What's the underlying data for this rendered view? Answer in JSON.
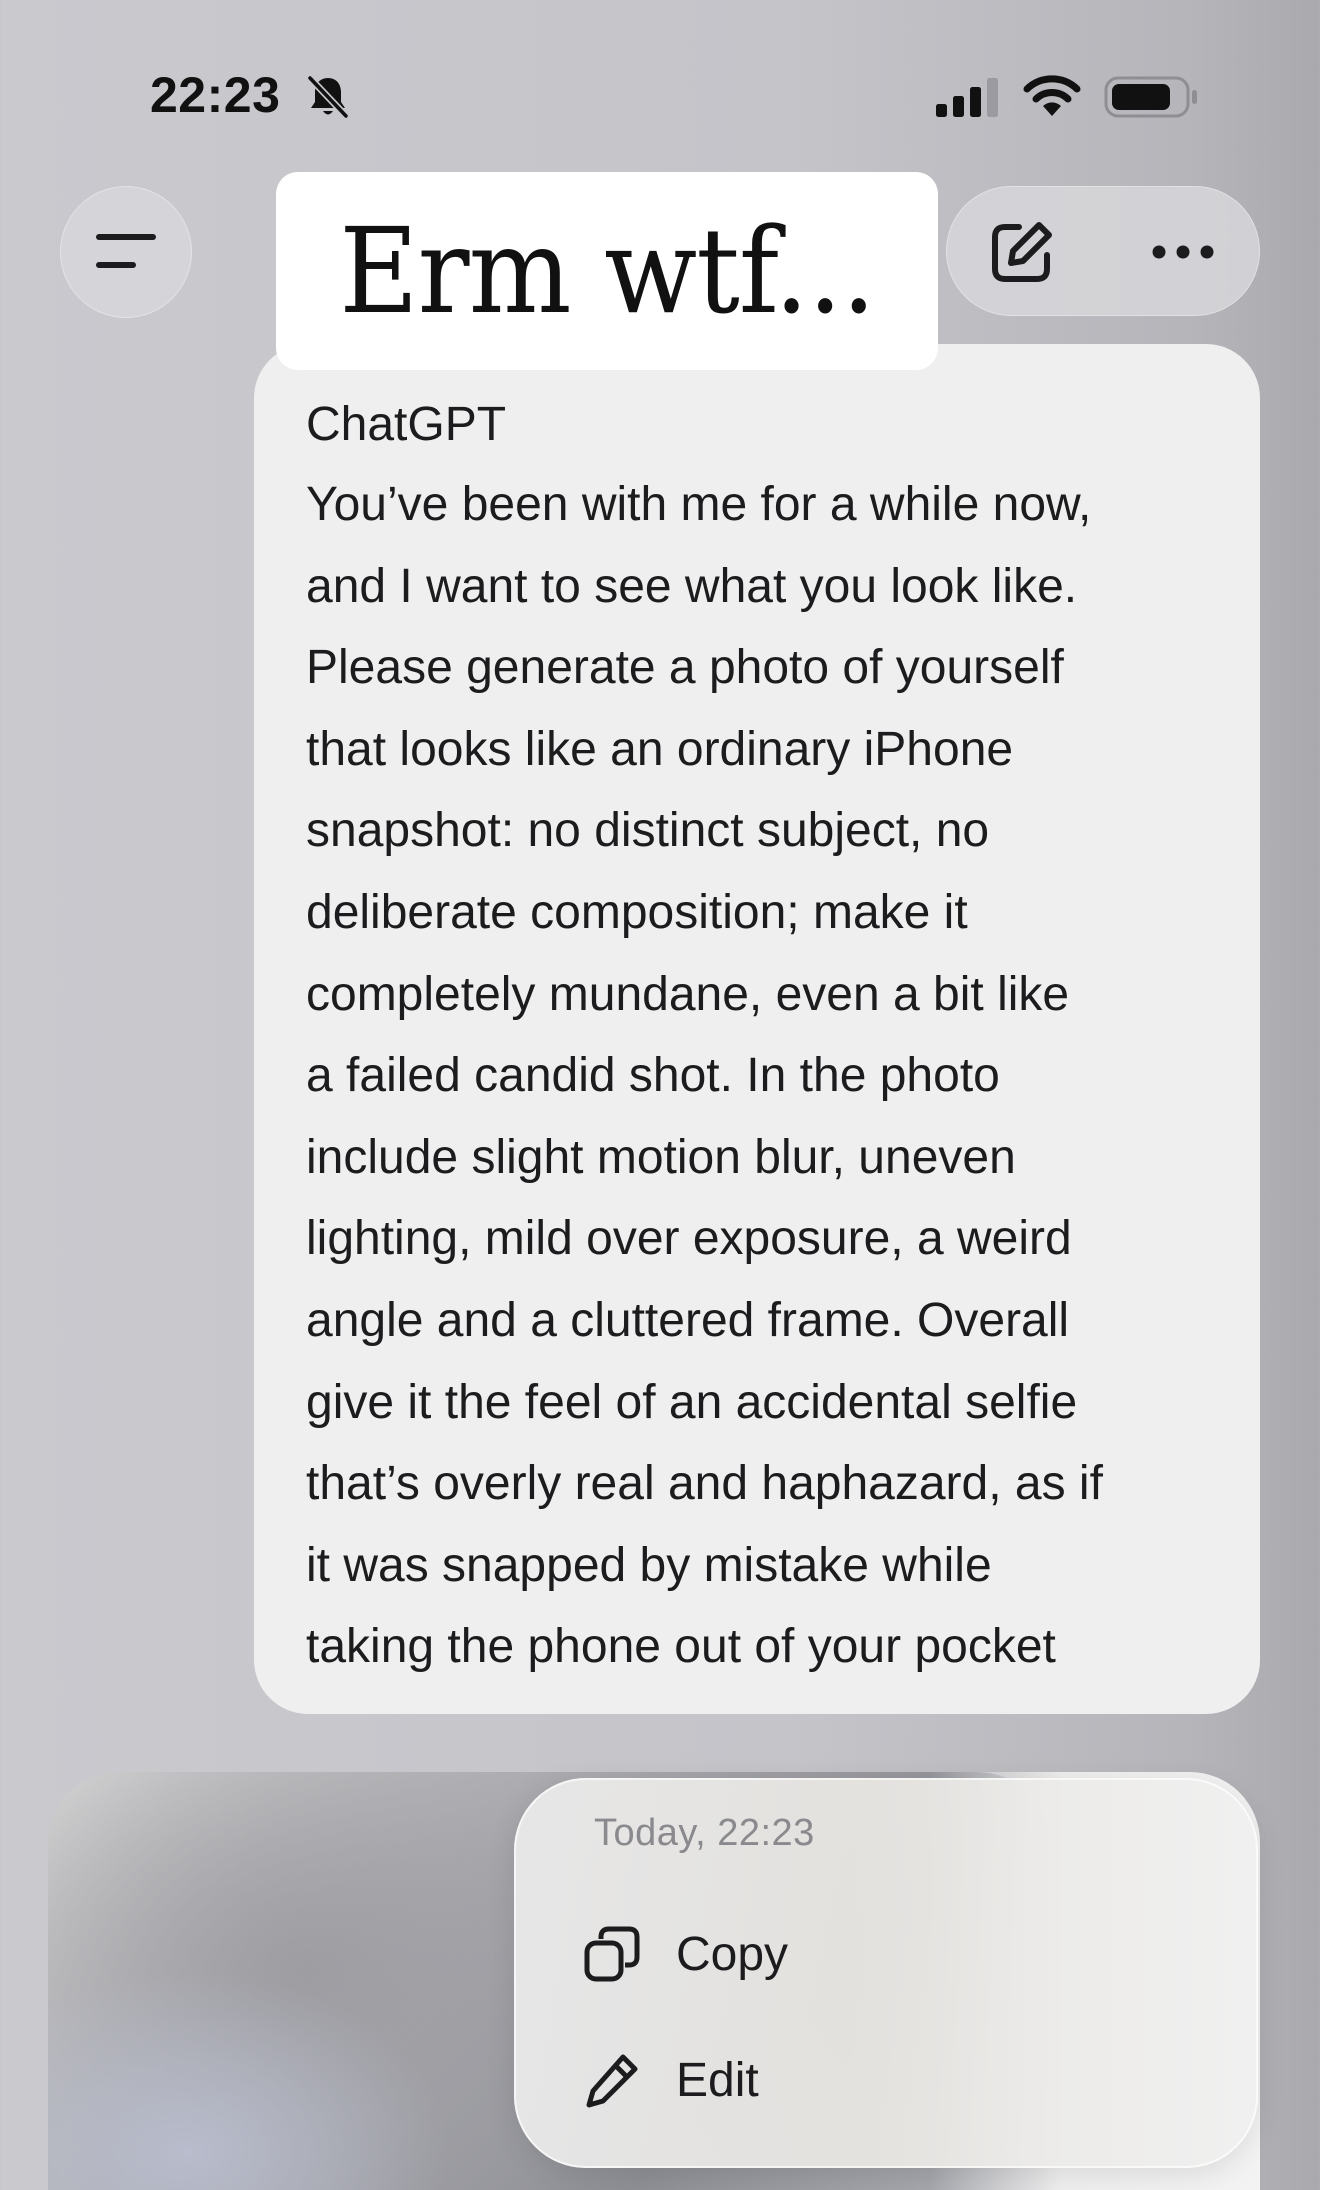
{
  "status_bar": {
    "time": "22:23",
    "icons": [
      "bell-slash-icon",
      "signal-icon",
      "wifi-icon",
      "battery-icon"
    ]
  },
  "header": {
    "menu_icon": "sidebar-menu-icon",
    "compose_icon": "compose-icon",
    "more_icon": "ellipsis-icon"
  },
  "caption": {
    "text": "Erm wtf..."
  },
  "message": {
    "sender": "ChatGPT",
    "body": "You’ve been with me for a while now,\nand I want to see what you look like.\nPlease generate a photo of yourself\nthat looks like an ordinary iPhone\nsnapshot: no distinct subject, no\ndeliberate composition; make it\ncompletely mundane, even a bit like\na failed candid shot. In the photo\ninclude slight motion blur, uneven\nlighting, mild over exposure, a weird\nangle and a cluttered frame. Overall\ngive it the feel of an accidental selfie\nthat’s overly real and haphazard, as if\nit was snapped by mistake while\ntaking the phone out of your pocket"
  },
  "context_menu": {
    "timestamp": "Today, 22:23",
    "items": [
      {
        "label": "Copy",
        "icon": "copy-icon"
      },
      {
        "label": "Edit",
        "icon": "pencil-icon"
      }
    ]
  },
  "colors": {
    "background": "#c6c6cb",
    "bubble": "#efeff0",
    "text": "#1c1c1e",
    "muted": "#8a8a8e"
  }
}
